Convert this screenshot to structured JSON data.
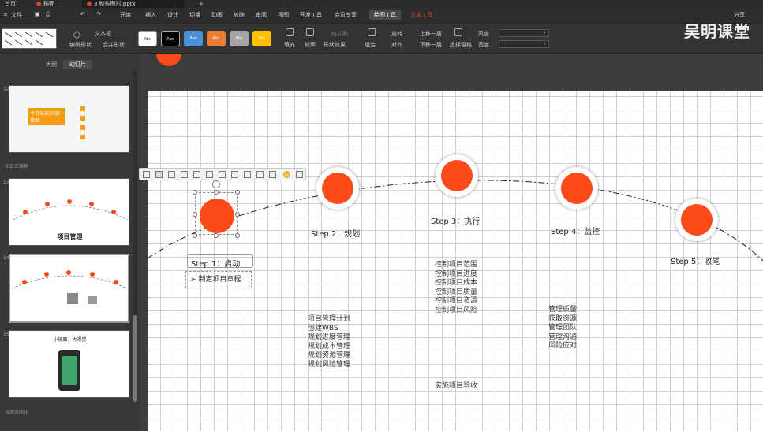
{
  "tabs": {
    "home": "首页",
    "shell": "稻壳",
    "doc": "3 制作图形.pptx",
    "add": "+"
  },
  "menu": {
    "file": "文件",
    "items": [
      "开始",
      "插入",
      "设计",
      "切换",
      "动画",
      "放映",
      "审阅",
      "视图",
      "开发工具",
      "会员专享"
    ],
    "active": "绘图工具",
    "red": "文本工具",
    "share": "分享"
  },
  "ribbon": {
    "textbox": "文本框",
    "merge_shapes": "合并形状",
    "edit_shape": "编辑形状",
    "style_label": "Abc",
    "fill": "填充",
    "outline": "轮廓",
    "shape_effects": "形状效果",
    "format_painter": "格式刷",
    "group": "组合",
    "rotate": "旋转",
    "align": "对齐",
    "bring_forward": "上移一层",
    "send_backward": "下移一层",
    "selection_pane": "选择窗格",
    "height": "高度",
    "width": "宽度",
    "swatch_colors": [
      "#ffffff",
      "#000000",
      "#4a90d9",
      "#ed7d31",
      "#a5a5a5",
      "#ffc000"
    ]
  },
  "watermark": "吴明课堂",
  "panel": {
    "outline_tab": "大纲",
    "slides_tab": "幻灯片",
    "section_1": "项目三维表",
    "section_2": "共两页图化",
    "thumbs": [
      {
        "num": "12",
        "title": "今日培训 内容提纲"
      },
      {
        "num": "13",
        "title": "项目管理"
      },
      {
        "num": "14",
        "title": ""
      },
      {
        "num": "15",
        "title": "小镜面，大视觉"
      }
    ]
  },
  "slide": {
    "accent": "#fc4a1a",
    "steps": [
      {
        "label": "Step 1：启动",
        "items": [
          "➢ 制定项目章程"
        ]
      },
      {
        "label": "Step 2：规划",
        "items": [
          "项目管理计划",
          "创建WBS",
          "规划进度管理",
          "规划成本管理",
          "规划资源管理",
          "规划风险管理"
        ]
      },
      {
        "label": "Step 3：执行",
        "items": [
          "控制项目范围",
          "控制项目进度",
          "控制项目成本",
          "控制项目质量",
          "控制项目资源",
          "控制项目风险"
        ],
        "extra": "实施项目验收"
      },
      {
        "label": "Step 4：监控",
        "items": [
          "管理质量",
          "获取资源",
          "管理团队",
          "管理沟通",
          "风险应对"
        ]
      },
      {
        "label": "Step 5：收尾",
        "items": []
      }
    ]
  }
}
